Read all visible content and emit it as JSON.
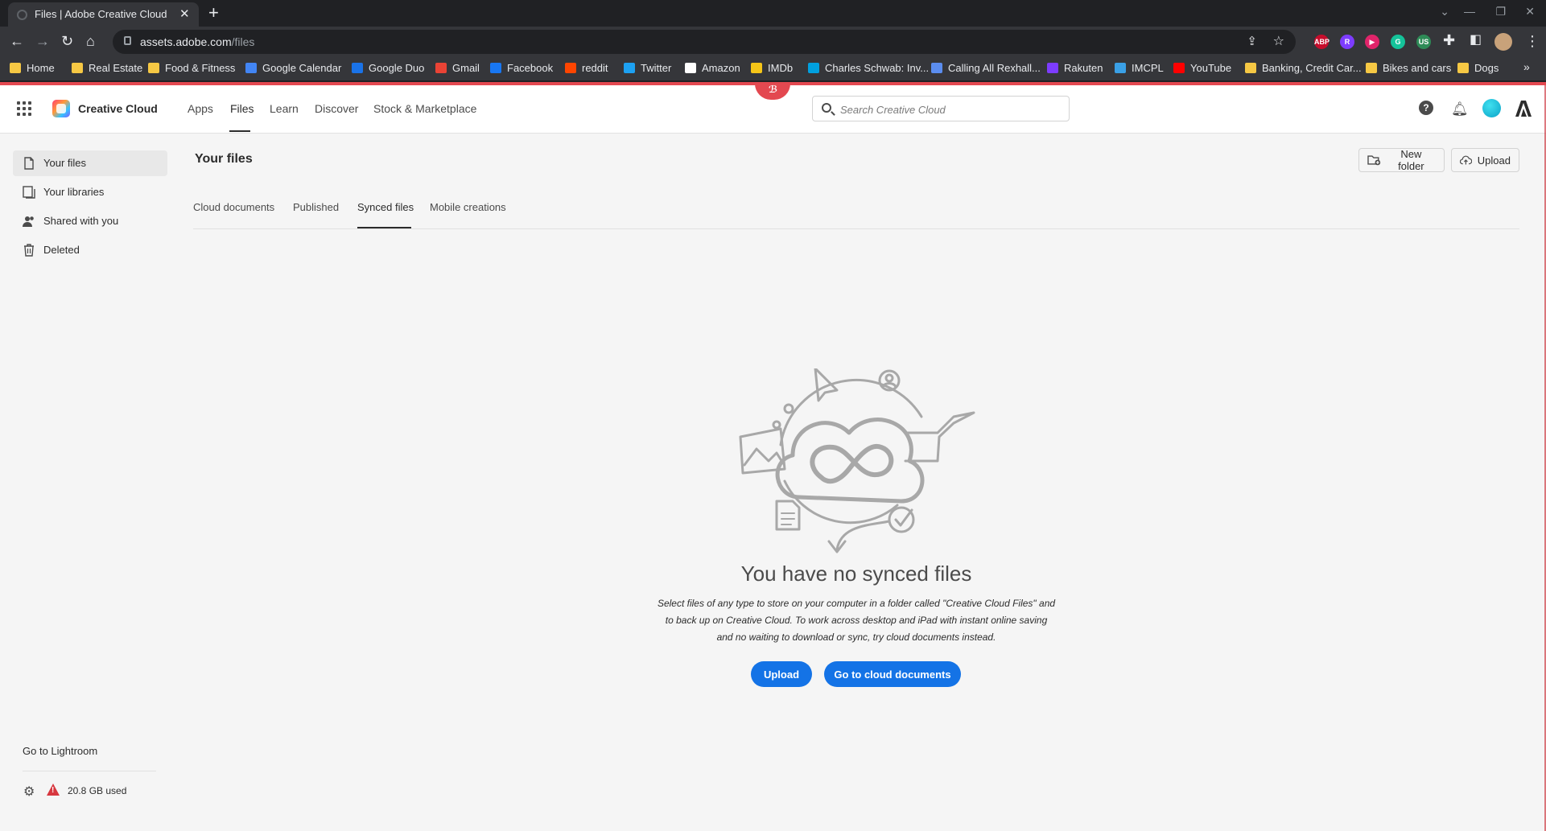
{
  "browser": {
    "tab_title": "Files | Adobe Creative Cloud",
    "url_host": "assets.adobe.com",
    "url_path": "/files",
    "bookmarks": [
      {
        "label": "Home",
        "color": "#f6c844"
      },
      {
        "label": "Real Estate",
        "color": "#f6c844"
      },
      {
        "label": "Food & Fitness",
        "color": "#f6c844"
      },
      {
        "label": "Google Calendar",
        "color": "#4285f4"
      },
      {
        "label": "Google Duo",
        "color": "#1a73e8"
      },
      {
        "label": "Gmail",
        "color": "#ea4335"
      },
      {
        "label": "Facebook",
        "color": "#1877f2"
      },
      {
        "label": "reddit",
        "color": "#ff4500"
      },
      {
        "label": "Twitter",
        "color": "#1da1f2"
      },
      {
        "label": "Amazon",
        "color": "#ffffff"
      },
      {
        "label": "IMDb",
        "color": "#f5c518"
      },
      {
        "label": "Charles Schwab: Inv...",
        "color": "#00a0df"
      },
      {
        "label": "Calling All Rexhall...",
        "color": "#5b8def"
      },
      {
        "label": "Rakuten",
        "color": "#7d3cff"
      },
      {
        "label": "IMCPL",
        "color": "#3aa0e6"
      },
      {
        "label": "YouTube",
        "color": "#ff0000"
      },
      {
        "label": "Banking, Credit Car...",
        "color": "#f6c844"
      },
      {
        "label": "Bikes and cars",
        "color": "#f6c844"
      },
      {
        "label": "Dogs",
        "color": "#f6c844"
      }
    ],
    "extensions": [
      {
        "label": "ABP",
        "color": "#c70d2c"
      },
      {
        "label": "R",
        "color": "#7d3cff"
      },
      {
        "label": "▶",
        "color": "#e0246a"
      },
      {
        "label": "G",
        "color": "#15c39a"
      },
      {
        "label": "US",
        "color": "#2e8b57"
      }
    ]
  },
  "header": {
    "brand": "Creative Cloud",
    "nav": [
      "Apps",
      "Files",
      "Learn",
      "Discover",
      "Stock & Marketplace"
    ],
    "active_nav": "Files",
    "search_placeholder": "Search Creative Cloud",
    "help_label": "?"
  },
  "sidebar": {
    "items": [
      {
        "label": "Your files",
        "icon": "file-icon",
        "active": true
      },
      {
        "label": "Your libraries",
        "icon": "library-icon",
        "active": false
      },
      {
        "label": "Shared with you",
        "icon": "users-icon",
        "active": false
      },
      {
        "label": "Deleted",
        "icon": "trash-icon",
        "active": false
      }
    ],
    "lightroom_link": "Go to Lightroom",
    "storage_used": "20.8 GB used",
    "storage_status_color": "#d7373f"
  },
  "main": {
    "title": "Your files",
    "new_folder_label": "New folder",
    "upload_label": "Upload",
    "tabs": [
      "Cloud documents",
      "Published",
      "Synced files",
      "Mobile creations"
    ],
    "active_tab": "Synced files",
    "empty_title": "You have no synced files",
    "empty_desc_line1": "Select files of any type to store on your computer in a folder called \"Creative Cloud Files\" and",
    "empty_desc_line2": "to back up on Creative Cloud. To work across desktop and iPad with instant online saving",
    "empty_desc_line3": "and no waiting to download or sync, try cloud documents instead.",
    "cta_upload": "Upload",
    "cta_cloud_docs": "Go to cloud documents"
  },
  "colors": {
    "accent": "#1473e6",
    "brand_red": "#e34850"
  }
}
